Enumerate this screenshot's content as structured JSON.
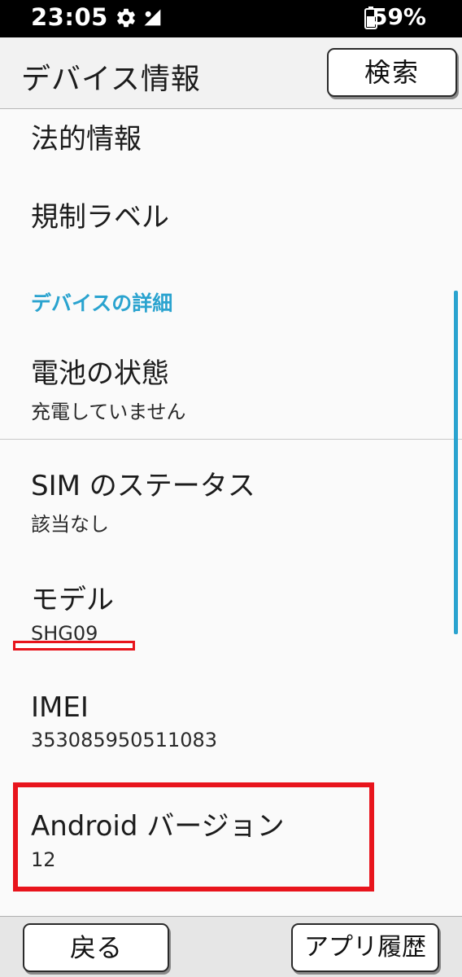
{
  "status_bar": {
    "time": "23:05",
    "battery_percent": "59%",
    "icons": [
      "gear-icon",
      "wifi-icon",
      "battery-icon"
    ]
  },
  "app_bar": {
    "title": "デバイス情報",
    "search_label": "検索"
  },
  "list": {
    "legal": {
      "title": "法的情報"
    },
    "regulatory": {
      "title": "規制ラベル"
    },
    "section_header": "デバイスの詳細",
    "battery": {
      "title": "電池の状態",
      "value": "充電していません"
    },
    "sim": {
      "title": "SIM のステータス",
      "value": "該当なし"
    },
    "model": {
      "title": "モデル",
      "value": "SHG09"
    },
    "imei": {
      "title": "IMEI",
      "value": "353085950511083"
    },
    "android": {
      "title": "Android バージョン",
      "value": "12"
    }
  },
  "nav_bar": {
    "back_label": "戻る",
    "history_label": "アプリ履歴"
  },
  "colors": {
    "accent": "#2aa3cf",
    "annotation_red": "#e8141c",
    "status_bar_bg": "#000000"
  }
}
